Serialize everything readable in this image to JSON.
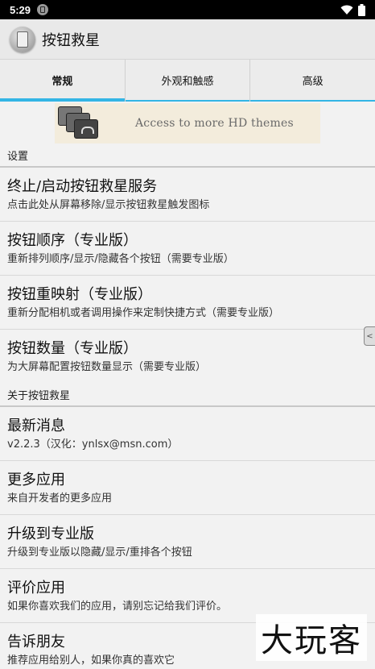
{
  "status_bar": {
    "time": "5:29"
  },
  "app_bar": {
    "title": "按钮救星",
    "icon": "app-icon"
  },
  "tabs": [
    {
      "label": "常规",
      "active": true
    },
    {
      "label": "外观和触感",
      "active": false
    },
    {
      "label": "高级",
      "active": false
    }
  ],
  "banner": {
    "text": "Access to more HD themes"
  },
  "sections": {
    "settings_header": "设置",
    "about_header": "关于按钮救星"
  },
  "settings_items": [
    {
      "title": "终止/启动按钮救星服务",
      "summary": "点击此处从屏幕移除/显示按钮救星触发图标"
    },
    {
      "title": "按钮顺序（专业版）",
      "summary": "重新排列顺序/显示/隐藏各个按钮（需要专业版）"
    },
    {
      "title": "按钮重映射（专业版）",
      "summary": "重新分配相机或者调用操作来定制快捷方式（需要专业版）"
    },
    {
      "title": "按钮数量（专业版）",
      "summary": "为大屏幕配置按钮数量显示（需要专业版）"
    }
  ],
  "about_items": [
    {
      "title": "最新消息",
      "summary": "v2.2.3（汉化：ynlsx@msn.com）"
    },
    {
      "title": "更多应用",
      "summary": "来自开发者的更多应用"
    },
    {
      "title": "升级到专业版",
      "summary": "升级到专业版以隐藏/显示/重排各个按钮"
    },
    {
      "title": "评价应用",
      "summary": "如果你喜欢我们的应用，请别忘记给我们评价。"
    },
    {
      "title": "告诉朋友",
      "summary": "推荐应用给别人，如果你真的喜欢它"
    }
  ],
  "watermark": "大玩客",
  "colors": {
    "accent": "#33b5e5",
    "background": "#f2f2f2"
  }
}
